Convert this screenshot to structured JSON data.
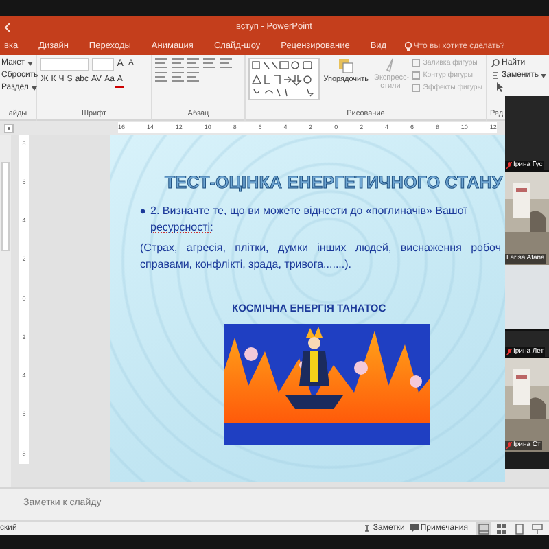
{
  "window": {
    "title": "вступ - PowerPoint"
  },
  "tabs": [
    {
      "label": "вка",
      "selected": false
    },
    {
      "label": "Дизайн",
      "selected": false
    },
    {
      "label": "Переходы",
      "selected": false
    },
    {
      "label": "Анимация",
      "selected": false
    },
    {
      "label": "Слайд-шоу",
      "selected": false
    },
    {
      "label": "Рецензирование",
      "selected": false
    },
    {
      "label": "Вид",
      "selected": false
    }
  ],
  "tell_me": {
    "placeholder": "Что вы хотите сделать?"
  },
  "ribbon": {
    "slides_group": {
      "label": "айды",
      "items": [
        {
          "label": "Макет",
          "dropdown": true
        },
        {
          "label": "Сбросить"
        },
        {
          "label": "Раздел",
          "dropdown": true
        }
      ]
    },
    "font_group": {
      "label": "Шрифт",
      "size_buttons": [
        "A",
        "A"
      ],
      "format_buttons": [
        "Ж",
        "К",
        "Ч",
        "S",
        "abc",
        "AV",
        "Aa"
      ],
      "color_button": "A"
    },
    "paragraph_group": {
      "label": "Абзац"
    },
    "drawing_group": {
      "label": "Рисование",
      "arrange": "Упорядочить",
      "quick_styles": {
        "label": "Экспресс-стили",
        "disabled": true
      },
      "shape_commands": [
        {
          "label": "Заливка фигуры",
          "disabled": true
        },
        {
          "label": "Контур фигуры",
          "disabled": true
        },
        {
          "label": "Эффекты фигуры",
          "disabled": true
        }
      ]
    },
    "editing_group": {
      "label": "Ред",
      "commands": [
        "Найти",
        "Заменить"
      ]
    }
  },
  "ruler": {
    "horizontal": [
      "16",
      "14",
      "12",
      "10",
      "8",
      "6",
      "4",
      "2",
      "0",
      "2",
      "4",
      "6",
      "8",
      "10",
      "12"
    ],
    "vertical": [
      "8",
      "6",
      "4",
      "2",
      "0",
      "2",
      "4",
      "6",
      "8"
    ]
  },
  "slide": {
    "title": "ТЕСТ-ОЦІНКА ЕНЕРГЕТИЧНОГО СТАНУ",
    "bullet_lines": [
      "2. Визначте те, що ви можете віднести до «поглиначів» Вашої",
      "ресурсності:"
    ],
    "paragraph_lines": [
      "(Страх, агресія, плітки, думки інших людей, виснаження робоч",
      "справами, конфлікті, зрада, тривога.......)."
    ],
    "caption": "КОСМІЧНА ЕНЕРГІЯ ТАНАТОС",
    "image": {
      "kind": "picture"
    }
  },
  "notes": {
    "placeholder": "Заметки к слайду"
  },
  "status_bar": {
    "language": "ский",
    "notes_button": "Заметки",
    "comments_button": "Примечания",
    "views": [
      {
        "kind": "normal",
        "selected": true
      },
      {
        "kind": "sorter",
        "selected": false
      },
      {
        "kind": "reading",
        "selected": false
      },
      {
        "kind": "show",
        "selected": false
      }
    ]
  },
  "participants": [
    {
      "name": "Ірина Гус",
      "kind": "dark",
      "muted": true
    },
    {
      "name": "Larisa Afana",
      "kind": "video",
      "muted": false
    },
    {
      "kind": "light"
    },
    {
      "name": "Ірина Лет",
      "kind": "dark",
      "muted": true
    },
    {
      "name": "Ірина Ст",
      "kind": "video",
      "muted": true
    }
  ]
}
